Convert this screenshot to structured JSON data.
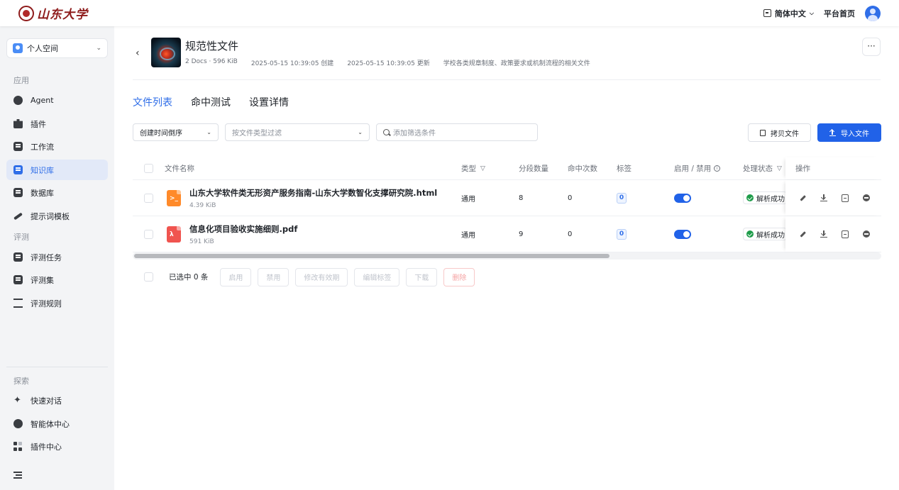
{
  "header": {
    "logo_text": "山东大学",
    "language": "简体中文",
    "home_link": "平台首页"
  },
  "sidebar": {
    "space": "个人空间",
    "section_apps": "应用",
    "apps": [
      {
        "label": "Agent",
        "icon": "agent-icon"
      },
      {
        "label": "插件",
        "icon": "puzzle-icon"
      },
      {
        "label": "工作流",
        "icon": "workflow-icon"
      },
      {
        "label": "知识库",
        "icon": "book-icon"
      },
      {
        "label": "数据库",
        "icon": "database-icon"
      },
      {
        "label": "提示词模板",
        "icon": "pen-icon"
      }
    ],
    "section_eval": "评测",
    "eval": [
      {
        "label": "评测任务",
        "icon": "task-icon"
      },
      {
        "label": "评测集",
        "icon": "dataset-icon"
      },
      {
        "label": "评测规则",
        "icon": "scale-icon"
      }
    ],
    "section_explore": "探索",
    "explore": [
      {
        "label": "快速对话",
        "icon": "sparkle-icon"
      },
      {
        "label": "智能体中心",
        "icon": "bot-icon"
      },
      {
        "label": "插件中心",
        "icon": "grid-icon"
      }
    ]
  },
  "kb": {
    "title": "规范性文件",
    "docs": "2 Docs · 596 KiB",
    "created": "2025-05-15 10:39:05 创建",
    "updated": "2025-05-15 10:39:05 更新",
    "description": "学校各类规章制度、政策要求或机制流程的相关文件",
    "more": "···"
  },
  "tabs": [
    "文件列表",
    "命中测试",
    "设置详情"
  ],
  "filters": {
    "sort": "创建时间倒序",
    "type_placeholder": "按文件类型过滤",
    "search_placeholder": "添加筛选条件"
  },
  "actions": {
    "copy": "拷贝文件",
    "import": "导入文件"
  },
  "table": {
    "headers": {
      "name": "文件名称",
      "type": "类型",
      "segments": "分段数量",
      "hits": "命中次数",
      "tags": "标签",
      "enabled": "启用 / 禁用",
      "status": "处理状态",
      "ops": "操作"
    },
    "rows": [
      {
        "name": "山东大学软件类无形资产服务指南-山东大学数智化支撑研究院.html",
        "size": "4.39 KiB",
        "kind": "html",
        "type": "通用",
        "segments": "8",
        "hits": "0",
        "tags": "0",
        "enabled": true,
        "status": "解析成功"
      },
      {
        "name": "信息化项目验收实施细则.pdf",
        "size": "591 KiB",
        "kind": "pdf",
        "type": "通用",
        "segments": "9",
        "hits": "0",
        "tags": "0",
        "enabled": true,
        "status": "解析成功"
      }
    ]
  },
  "bulk": {
    "selected": "已选中 0 条",
    "enable": "启用",
    "disable": "禁用",
    "edit_validity": "修改有效期",
    "edit_tags": "编辑标签",
    "download": "下载",
    "delete": "删除"
  },
  "colors": {
    "accent": "#2162e8",
    "success": "#1e9c4a",
    "danger": "#f5a3a3"
  }
}
